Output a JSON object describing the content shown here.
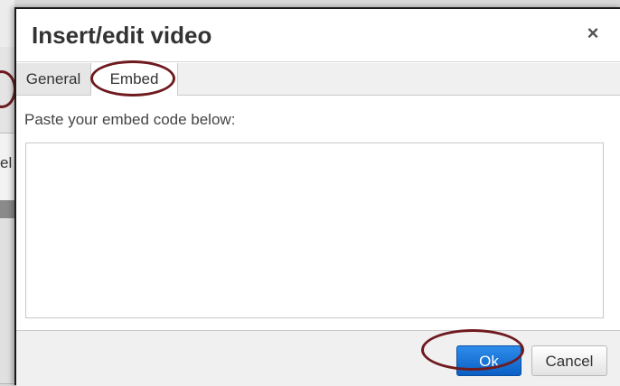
{
  "dialog": {
    "title": "Insert/edit video",
    "close_glyph": "×",
    "close_icon": "close-icon"
  },
  "tabs": [
    {
      "label": "General",
      "active": false
    },
    {
      "label": "Embed",
      "active": true
    }
  ],
  "embed": {
    "label": "Paste your embed code below:",
    "value": "",
    "placeholder": ""
  },
  "footer": {
    "ok_label": "Ok",
    "cancel_label": "Cancel"
  },
  "background": {
    "partial_text": "el"
  },
  "colors": {
    "annotation_ring": "#6e1a1f",
    "primary_button": "#0a5fc4"
  }
}
